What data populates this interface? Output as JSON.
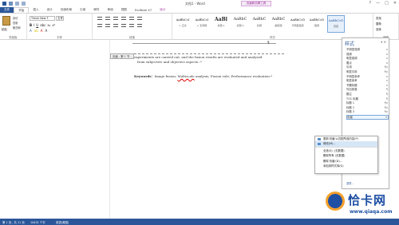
{
  "window": {
    "title": "文档1 - Word",
    "context_tab_group": "页眉和页脚工具",
    "controls": [
      "?",
      "—",
      "□",
      "✕"
    ]
  },
  "tabs": [
    "文件",
    "开始",
    "插入",
    "设计",
    "页面布局",
    "引用",
    "邮件",
    "审阅",
    "视图",
    "EndNote X7",
    "设计"
  ],
  "ribbon": {
    "clipboard": {
      "paste": "粘贴",
      "cut": "剪切",
      "copy": "复制",
      "format_painter": "格式刷",
      "label": "剪贴板"
    },
    "font": {
      "name": "Times New F",
      "size": "五号",
      "label": "字体"
    },
    "paragraph": {
      "label": "段落"
    },
    "styles": {
      "label": "样式",
      "tiles": [
        {
          "sample": "AaBbCcI",
          "name": "↵ 正文"
        },
        {
          "sample": "AaBbCcI",
          "name": "↵ 无间隔"
        },
        {
          "sample": "AaBl",
          "name": "标题 1"
        },
        {
          "sample": "AaBbC",
          "name": "标题 2"
        },
        {
          "sample": "AaBbC",
          "name": "标题"
        },
        {
          "sample": "AaBbC",
          "name": "副标题"
        },
        {
          "sample": "AaBbCcD",
          "name": "不明显强调"
        },
        {
          "sample": "AaBbCcD",
          "name": "强调"
        },
        {
          "sample": "AaBbCcD",
          "name": "页眉"
        }
      ]
    },
    "editing": {
      "find": "查找",
      "replace": "替换",
      "select": "选择",
      "label": "编辑"
    }
  },
  "document": {
    "header_label": "页眉 - 第 1 节 -",
    "body_line_1": "experiments are carried out, and the fusion results are evaluated and analyzed",
    "body_line_2": "from subjective and objective aspects.↵",
    "keywords_label": "Keywords：",
    "keywords_pre": "Image fusion; ",
    "keywords_misspelled": "Multiscale",
    "keywords_post": " analysis; Fusion rule; Performance evaluation↵"
  },
  "styles_pane": {
    "title": "样式",
    "close": "▾ ✕",
    "items": [
      {
        "name": "不明显强调",
        "mark": "a"
      },
      {
        "name": "强调",
        "mark": "a"
      },
      {
        "name": "明显强调",
        "mark": "a"
      },
      {
        "name": "要点",
        "mark": "a"
      },
      {
        "name": "引用",
        "mark": "¶a"
      },
      {
        "name": "明显引用",
        "mark": "¶a"
      },
      {
        "name": "不明显参考",
        "mark": "a"
      },
      {
        "name": "明显参考",
        "mark": "a"
      },
      {
        "name": "书籍标题",
        "mark": "a"
      },
      {
        "name": "列出段落",
        "mark": "¶"
      },
      {
        "name": "题注",
        "mark": "¶"
      },
      {
        "name": "TOC 标题",
        "mark": "¶"
      },
      {
        "name": "标题 1",
        "mark": "¶a"
      },
      {
        "name": "标题 2",
        "mark": "¶a"
      },
      {
        "name": "标题 3",
        "mark": "¶a"
      },
      {
        "name": "页眉",
        "mark": "▾"
      }
    ],
    "selected_index": 15,
    "options_link": "选项..."
  },
  "context_menu": {
    "items": [
      {
        "label": "更新'页眉'以匹配所选内容(P)"
      },
      {
        "label": "修改(M)..."
      },
      {
        "label": "全选(S): (无数据)"
      },
      {
        "label": "删除所有 (无数据)"
      },
      {
        "label": "删除'页眉'(D)..."
      },
      {
        "label": "添加到样式库(G)"
      }
    ],
    "highlighted_index": 1
  },
  "statusbar": {
    "page": "第 1 页，共 11 页",
    "words": "14431 个字",
    "lang": "英语(美国)"
  },
  "watermark": {
    "brand": "恰卡网",
    "site": "www.qiaqa.com"
  },
  "colors": {
    "accent": "#2b579a",
    "context": "#9c2a98",
    "watermark": "#1e4fa3"
  }
}
